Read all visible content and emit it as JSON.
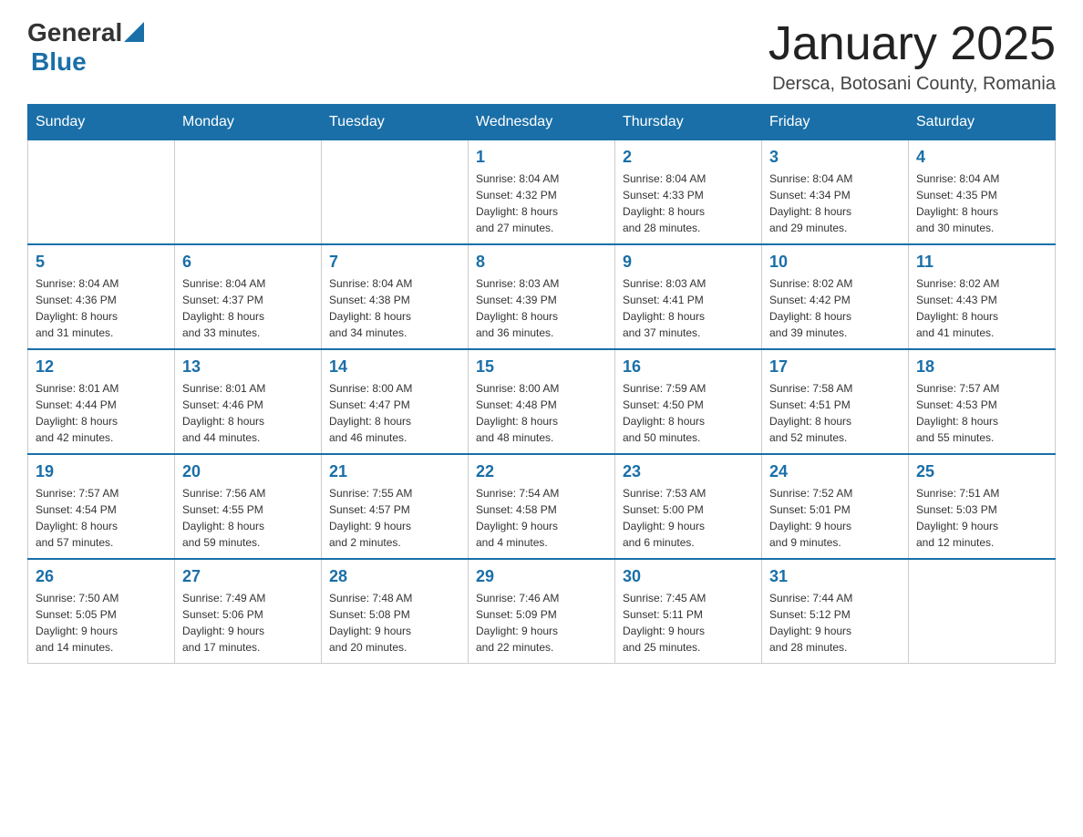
{
  "logo": {
    "general": "General",
    "blue": "Blue"
  },
  "title": "January 2025",
  "location": "Dersca, Botosani County, Romania",
  "headers": [
    "Sunday",
    "Monday",
    "Tuesday",
    "Wednesday",
    "Thursday",
    "Friday",
    "Saturday"
  ],
  "weeks": [
    [
      {
        "day": "",
        "info": ""
      },
      {
        "day": "",
        "info": ""
      },
      {
        "day": "",
        "info": ""
      },
      {
        "day": "1",
        "info": "Sunrise: 8:04 AM\nSunset: 4:32 PM\nDaylight: 8 hours\nand 27 minutes."
      },
      {
        "day": "2",
        "info": "Sunrise: 8:04 AM\nSunset: 4:33 PM\nDaylight: 8 hours\nand 28 minutes."
      },
      {
        "day": "3",
        "info": "Sunrise: 8:04 AM\nSunset: 4:34 PM\nDaylight: 8 hours\nand 29 minutes."
      },
      {
        "day": "4",
        "info": "Sunrise: 8:04 AM\nSunset: 4:35 PM\nDaylight: 8 hours\nand 30 minutes."
      }
    ],
    [
      {
        "day": "5",
        "info": "Sunrise: 8:04 AM\nSunset: 4:36 PM\nDaylight: 8 hours\nand 31 minutes."
      },
      {
        "day": "6",
        "info": "Sunrise: 8:04 AM\nSunset: 4:37 PM\nDaylight: 8 hours\nand 33 minutes."
      },
      {
        "day": "7",
        "info": "Sunrise: 8:04 AM\nSunset: 4:38 PM\nDaylight: 8 hours\nand 34 minutes."
      },
      {
        "day": "8",
        "info": "Sunrise: 8:03 AM\nSunset: 4:39 PM\nDaylight: 8 hours\nand 36 minutes."
      },
      {
        "day": "9",
        "info": "Sunrise: 8:03 AM\nSunset: 4:41 PM\nDaylight: 8 hours\nand 37 minutes."
      },
      {
        "day": "10",
        "info": "Sunrise: 8:02 AM\nSunset: 4:42 PM\nDaylight: 8 hours\nand 39 minutes."
      },
      {
        "day": "11",
        "info": "Sunrise: 8:02 AM\nSunset: 4:43 PM\nDaylight: 8 hours\nand 41 minutes."
      }
    ],
    [
      {
        "day": "12",
        "info": "Sunrise: 8:01 AM\nSunset: 4:44 PM\nDaylight: 8 hours\nand 42 minutes."
      },
      {
        "day": "13",
        "info": "Sunrise: 8:01 AM\nSunset: 4:46 PM\nDaylight: 8 hours\nand 44 minutes."
      },
      {
        "day": "14",
        "info": "Sunrise: 8:00 AM\nSunset: 4:47 PM\nDaylight: 8 hours\nand 46 minutes."
      },
      {
        "day": "15",
        "info": "Sunrise: 8:00 AM\nSunset: 4:48 PM\nDaylight: 8 hours\nand 48 minutes."
      },
      {
        "day": "16",
        "info": "Sunrise: 7:59 AM\nSunset: 4:50 PM\nDaylight: 8 hours\nand 50 minutes."
      },
      {
        "day": "17",
        "info": "Sunrise: 7:58 AM\nSunset: 4:51 PM\nDaylight: 8 hours\nand 52 minutes."
      },
      {
        "day": "18",
        "info": "Sunrise: 7:57 AM\nSunset: 4:53 PM\nDaylight: 8 hours\nand 55 minutes."
      }
    ],
    [
      {
        "day": "19",
        "info": "Sunrise: 7:57 AM\nSunset: 4:54 PM\nDaylight: 8 hours\nand 57 minutes."
      },
      {
        "day": "20",
        "info": "Sunrise: 7:56 AM\nSunset: 4:55 PM\nDaylight: 8 hours\nand 59 minutes."
      },
      {
        "day": "21",
        "info": "Sunrise: 7:55 AM\nSunset: 4:57 PM\nDaylight: 9 hours\nand 2 minutes."
      },
      {
        "day": "22",
        "info": "Sunrise: 7:54 AM\nSunset: 4:58 PM\nDaylight: 9 hours\nand 4 minutes."
      },
      {
        "day": "23",
        "info": "Sunrise: 7:53 AM\nSunset: 5:00 PM\nDaylight: 9 hours\nand 6 minutes."
      },
      {
        "day": "24",
        "info": "Sunrise: 7:52 AM\nSunset: 5:01 PM\nDaylight: 9 hours\nand 9 minutes."
      },
      {
        "day": "25",
        "info": "Sunrise: 7:51 AM\nSunset: 5:03 PM\nDaylight: 9 hours\nand 12 minutes."
      }
    ],
    [
      {
        "day": "26",
        "info": "Sunrise: 7:50 AM\nSunset: 5:05 PM\nDaylight: 9 hours\nand 14 minutes."
      },
      {
        "day": "27",
        "info": "Sunrise: 7:49 AM\nSunset: 5:06 PM\nDaylight: 9 hours\nand 17 minutes."
      },
      {
        "day": "28",
        "info": "Sunrise: 7:48 AM\nSunset: 5:08 PM\nDaylight: 9 hours\nand 20 minutes."
      },
      {
        "day": "29",
        "info": "Sunrise: 7:46 AM\nSunset: 5:09 PM\nDaylight: 9 hours\nand 22 minutes."
      },
      {
        "day": "30",
        "info": "Sunrise: 7:45 AM\nSunset: 5:11 PM\nDaylight: 9 hours\nand 25 minutes."
      },
      {
        "day": "31",
        "info": "Sunrise: 7:44 AM\nSunset: 5:12 PM\nDaylight: 9 hours\nand 28 minutes."
      },
      {
        "day": "",
        "info": ""
      }
    ]
  ]
}
